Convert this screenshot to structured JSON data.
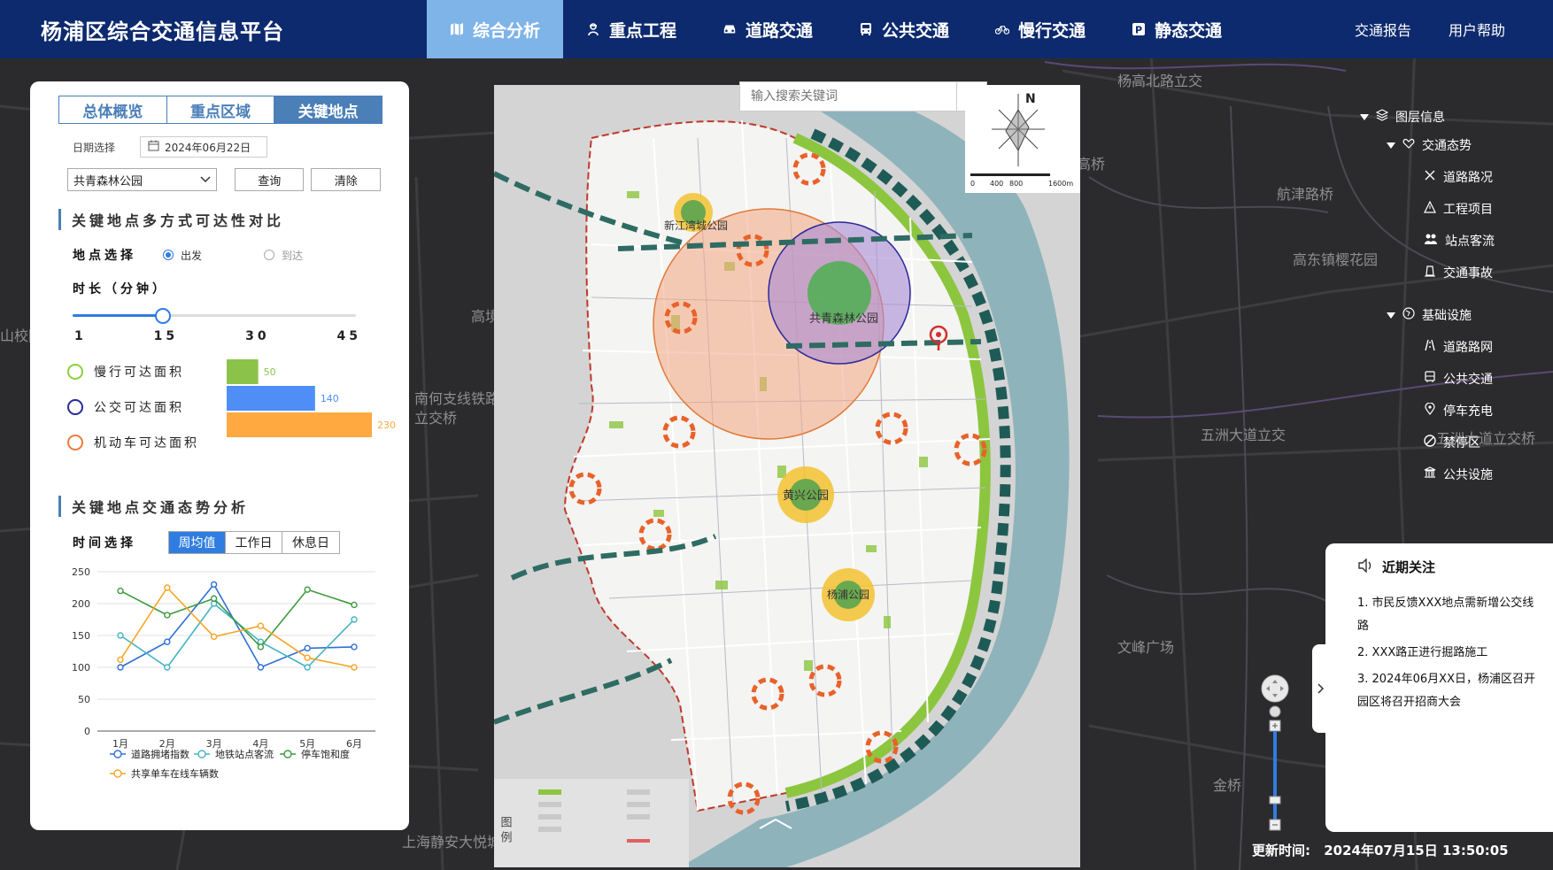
{
  "app": {
    "title": "杨浦区综合交通信息平台"
  },
  "nav": [
    {
      "label": "综合分析",
      "icon": "map-icon",
      "active": true
    },
    {
      "label": "重点工程",
      "icon": "worker-icon"
    },
    {
      "label": "道路交通",
      "icon": "car-icon"
    },
    {
      "label": "公共交通",
      "icon": "bus-icon"
    },
    {
      "label": "慢行交通",
      "icon": "bicycle-icon"
    },
    {
      "label": "静态交通",
      "icon": "parking-icon"
    }
  ],
  "top_links": {
    "report": "交通报告",
    "help": "用户帮助"
  },
  "left": {
    "tabs": [
      "总体概览",
      "重点区域",
      "关键地点"
    ],
    "active_tab": 2,
    "date_label": "日期选择",
    "date_value": "2024年06月22日",
    "location_value": "共青森林公园",
    "query_btn": "查询",
    "clear_btn": "清除",
    "sec1_title": "关键地点多方式可达性对比",
    "point_select_label": "地点选择",
    "radio_depart": "出发",
    "radio_arrive": "到达",
    "duration_label": "时长（分钟）",
    "duration_ticks": [
      "1",
      "15",
      "30",
      "45"
    ],
    "duration_value": 15,
    "reach": [
      {
        "label": "慢行可达面积",
        "value": 50,
        "color": "#8bc34a",
        "ring": "#8bd13b"
      },
      {
        "label": "公交可达面积",
        "value": 140,
        "color": "#4f8ef7",
        "ring": "#2a2a9a"
      },
      {
        "label": "机动车可达面积",
        "value": 230,
        "color": "#ffa940",
        "ring": "#f07a3a"
      }
    ],
    "sec2_title": "关键地点交通态势分析",
    "time_select_label": "时间选择",
    "time_tabs": [
      "周均值",
      "工作日",
      "休息日"
    ],
    "time_active": 0
  },
  "chart_data": {
    "type": "line",
    "categories": [
      "1月",
      "2月",
      "3月",
      "4月",
      "5月",
      "6月"
    ],
    "ylim": [
      0,
      250
    ],
    "yticks": [
      0,
      50,
      100,
      150,
      200,
      250
    ],
    "series": [
      {
        "name": "道路拥堵指数",
        "color": "#2f6fd6",
        "values": [
          100,
          140,
          230,
          100,
          130,
          132
        ]
      },
      {
        "name": "地铁站点客流",
        "color": "#45b3c2",
        "values": [
          150,
          100,
          200,
          140,
          100,
          175
        ]
      },
      {
        "name": "停车饱和度",
        "color": "#3c9a3c",
        "values": [
          220,
          182,
          208,
          132,
          222,
          198
        ]
      },
      {
        "name": "共享单车在线车辆数",
        "color": "#f5a623",
        "values": [
          112,
          225,
          148,
          165,
          115,
          100
        ]
      }
    ]
  },
  "map": {
    "search_placeholder": "输入搜索关键词",
    "compass_n": "N",
    "scale": [
      "0",
      "400",
      "800",
      "1600m"
    ],
    "parks": [
      "新江湾城公园",
      "共青森林公园",
      "黄兴公园",
      "杨浦公园"
    ],
    "legend_label": "图 例"
  },
  "bg_labels": [
    "杨高北路立交",
    "航津路桥",
    "高东镇樱花园",
    "五洲大道立交",
    "五洲大道立交桥",
    "南何支线铁路立交桥",
    "文峰广场",
    "金桥",
    "上海静安大悦城",
    "上海外高桥造船",
    "高桥",
    "高境",
    "立交桥",
    "山校园",
    "上海"
  ],
  "layers": {
    "root": "图层信息",
    "group1": "交通态势",
    "group1_items": [
      "道路路况",
      "工程项目",
      "站点客流",
      "交通事故"
    ],
    "group2": "基础设施",
    "group2_items": [
      "道路路网",
      "公共交通",
      "停车充电",
      "禁停区",
      "公共设施"
    ]
  },
  "news": {
    "title": "近期关注",
    "items": [
      "1. 市民反馈XXX地点需新增公交线路",
      "2. XXX路正进行掘路施工",
      "3. 2024年06月XX日，杨浦区召开园区将召开招商大会"
    ]
  },
  "update": {
    "label": "更新时间:",
    "value": "2024年07月15日  13:50:05"
  }
}
